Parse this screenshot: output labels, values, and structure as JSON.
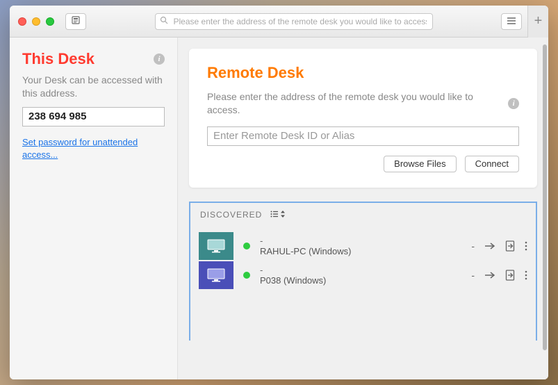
{
  "toolbar": {
    "search_placeholder": "Please enter the address of the remote desk you would like to access."
  },
  "sidebar": {
    "title": "This Desk",
    "desc": "Your Desk can be accessed with this address.",
    "desk_id": "238 694 985",
    "set_password_label": "Set password for unattended access..."
  },
  "remote": {
    "title": "Remote Desk",
    "desc": "Please enter the address of the remote desk you would like to access.",
    "input_placeholder": "Enter Remote Desk ID or Alias",
    "browse_label": "Browse Files",
    "connect_label": "Connect"
  },
  "discovered": {
    "header": "DISCOVERED",
    "items": [
      {
        "alias": "-",
        "name": "RAHUL-PC (Windows)",
        "thumb_color": "teal",
        "status": "online",
        "last": "-"
      },
      {
        "alias": "-",
        "name": "P038 (Windows)",
        "thumb_color": "blue",
        "status": "online",
        "last": "-"
      }
    ]
  }
}
